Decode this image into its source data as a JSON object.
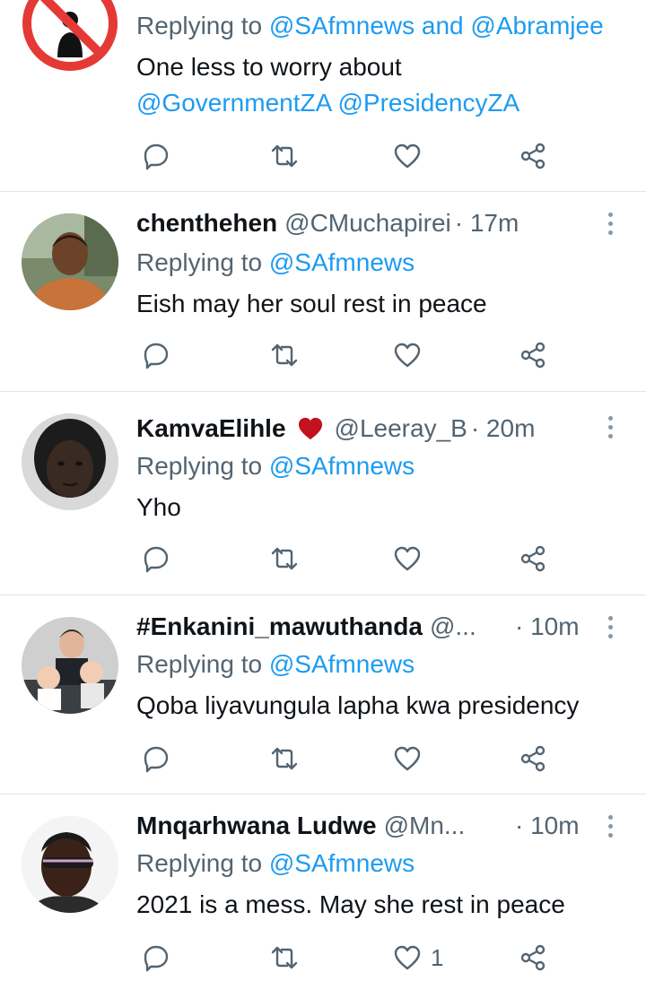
{
  "tweets": [
    {
      "author": null,
      "replying_prefix": "Replying to",
      "replying_to": "@SAfmnews and @Abramjee",
      "text": "One less to worry about",
      "text_mentions": "@GovernmentZA @PresidencyZA",
      "like_count": ""
    },
    {
      "name": "chenthehen",
      "handle": "@CMuchapirei",
      "time": "· 17m",
      "replying_prefix": "Replying to",
      "replying_to": "@SAfmnews",
      "text": "Eish may her soul rest in peace",
      "like_count": ""
    },
    {
      "name": "KamvaElihle",
      "handle": "@Leeray_B",
      "time": "· 20m",
      "replying_prefix": "Replying to",
      "replying_to": "@SAfmnews",
      "text": "Yho",
      "like_count": ""
    },
    {
      "name": "#Enkanini_mawuthanda",
      "handle": "@...",
      "time": "· 10m",
      "replying_prefix": "Replying to",
      "replying_to": "@SAfmnews",
      "text": "Qoba liyavungula lapha kwa presidency",
      "like_count": ""
    },
    {
      "name": "Mnqarhwana Ludwe",
      "handle": "@Mn...",
      "time": "· 10m",
      "replying_prefix": "Replying to",
      "replying_to": "@SAfmnews",
      "text": "2021 is a mess. May she rest in peace",
      "like_count": "1"
    }
  ],
  "colors": {
    "accent": "#1d9bf0",
    "secondary": "#536471",
    "heart": "#c1121f"
  },
  "icons": [
    "reply-icon",
    "retweet-icon",
    "like-icon",
    "share-icon",
    "more-icon",
    "heart-emoji-icon"
  ]
}
